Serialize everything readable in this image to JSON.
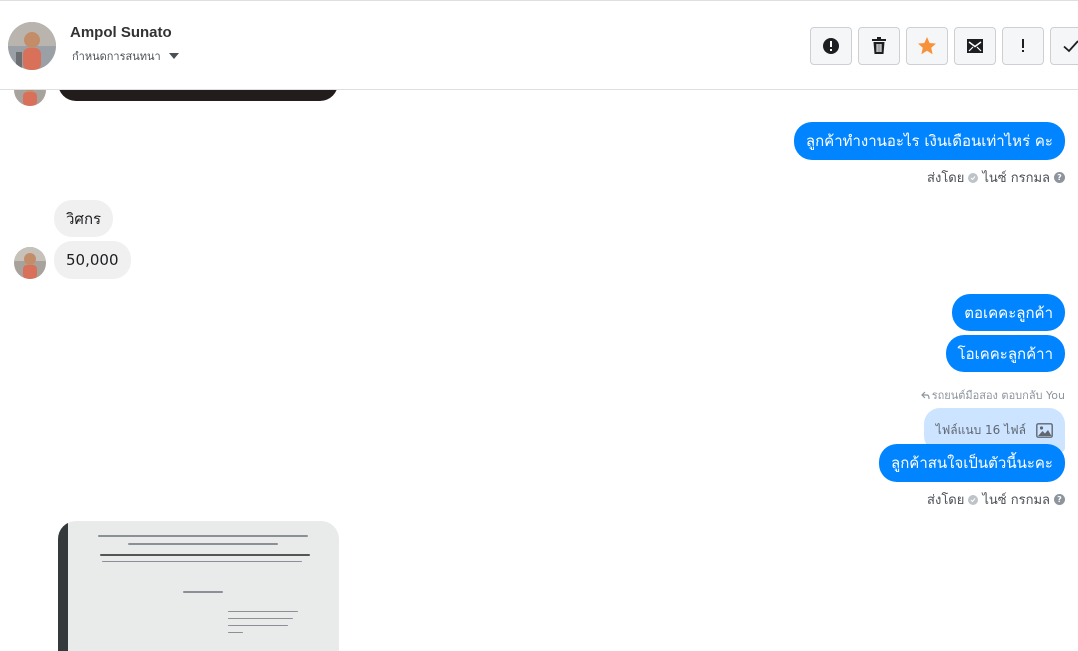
{
  "header": {
    "contact_name": "Ampol Sunato",
    "assign_label": "กำหนดการสนทนา",
    "actions": [
      {
        "name": "report-button",
        "icon": "alert-icon"
      },
      {
        "name": "delete-button",
        "icon": "trash-icon"
      },
      {
        "name": "star-button",
        "icon": "star-icon"
      },
      {
        "name": "mark-unread-button",
        "icon": "envelope-icon"
      },
      {
        "name": "important-button",
        "icon": "exclamation-icon"
      },
      {
        "name": "done-button",
        "icon": "check-icon"
      }
    ]
  },
  "messages": {
    "m1": "ลูกค้าทำงานอะไร เงินเดือนเท่าไหร่ คะ",
    "m1_sent_by": "ส่งโดย",
    "m1_sender": "ไนซ์ กรกมล",
    "in1": "วิศกร",
    "in2": "50,000",
    "m2": "ตอเคคะลูกค้า",
    "m3": "โอเคคะลูกค้าา",
    "reply_note": "รถยนต์มือสอง ตอบกลับ You",
    "attachment_label": "ไฟล์แนบ 16 ไฟล์",
    "m4": "ลูกค้าสนใจเป็นตัวนี้นะคะ",
    "m4_sent_by": "ส่งโดย",
    "m4_sender": "ไนซ์ กรกมล"
  },
  "colors": {
    "outgoing": "#0084ff",
    "incoming": "#f1f0f0",
    "star": "#f7923b",
    "attachment": "#cce4ff"
  }
}
